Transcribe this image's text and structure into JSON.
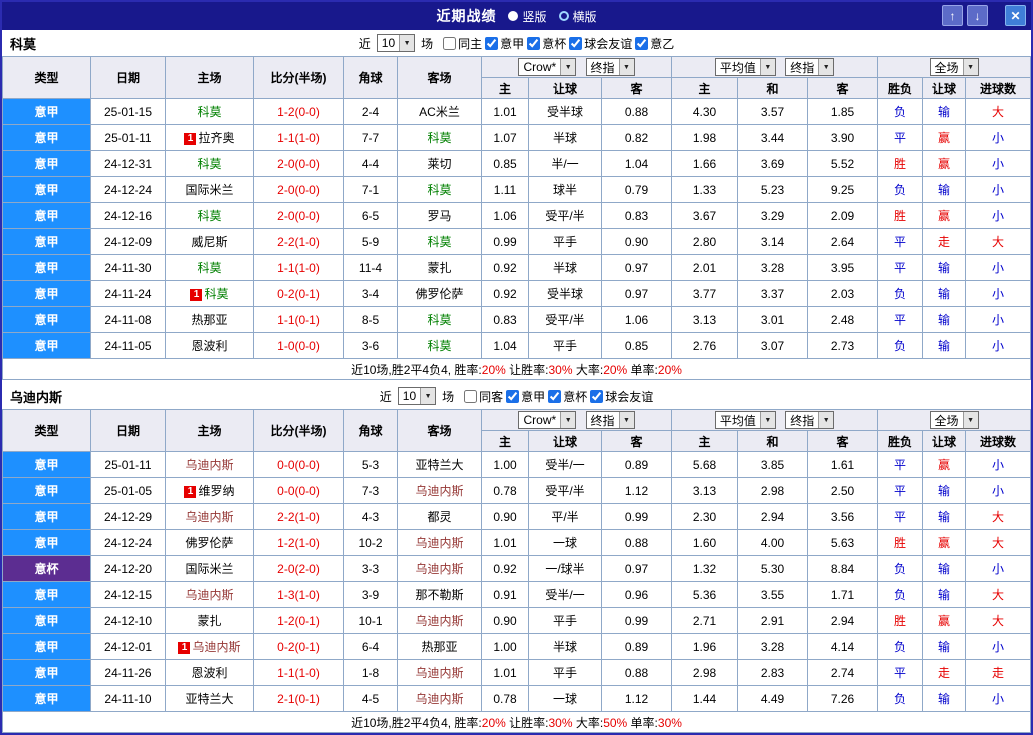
{
  "titlebar": {
    "title": "近期战绩",
    "radios": [
      {
        "label": "竖版",
        "selected": true
      },
      {
        "label": "横版",
        "selected": false
      }
    ],
    "up_icon": "↑",
    "down_icon": "↓",
    "close_icon": "✕"
  },
  "icons": {
    "dropdown_arrow": "▼"
  },
  "badges": {
    "red_card": "1"
  },
  "filter_labels": {
    "near": "近",
    "count": "10",
    "games": "场"
  },
  "table": {
    "main_cols": [
      "类型",
      "日期",
      "主场",
      "比分(半场)",
      "角球",
      "客场"
    ],
    "sub_cols": [
      "主",
      "让球",
      "客",
      "主",
      "和",
      "客",
      "胜负",
      "让球",
      "进球数"
    ],
    "selects": {
      "bookmaker": "Crow*",
      "final1": "终指",
      "average": "平均值",
      "final2": "终指",
      "scope": "全场"
    }
  },
  "colors": {
    "league_type_bg": "#1e90ff",
    "cup_type_bg": "#5c2d91",
    "score_red": "#e60000",
    "loss_blue": "#0000cc",
    "team_green": "#008000",
    "team_maroon": "#953735",
    "titlebar_bg": "#18188c"
  },
  "sections": [
    {
      "team": "科莫",
      "filters": [
        {
          "label": "同主",
          "name": "same-home",
          "checked": false
        },
        {
          "label": "意甲",
          "name": "serie-a",
          "checked": true
        },
        {
          "label": "意杯",
          "name": "coppa-italia",
          "checked": true
        },
        {
          "label": "球会友谊",
          "name": "club-friendly",
          "checked": true
        },
        {
          "label": "意乙",
          "name": "serie-b",
          "checked": true
        }
      ],
      "rows": [
        {
          "type": [
            "意甲",
            "lg"
          ],
          "date": "25-01-15",
          "home": [
            "科莫",
            "g",
            0
          ],
          "score": "1-2(0-0)",
          "corners": "2-4",
          "away": [
            "AC米兰",
            "k",
            0
          ],
          "odds": [
            "1.01",
            "受半球",
            "0.88"
          ],
          "avg": [
            "4.30",
            "3.57",
            "1.85"
          ],
          "results": [
            [
              "负",
              "b"
            ],
            [
              "输",
              "b"
            ],
            [
              "大",
              "r"
            ]
          ]
        },
        {
          "type": [
            "意甲",
            "lg"
          ],
          "date": "25-01-11",
          "home": [
            "拉齐奥",
            "k",
            1
          ],
          "score": "1-1(1-0)",
          "corners": "7-7",
          "away": [
            "科莫",
            "g",
            0
          ],
          "odds": [
            "1.07",
            "半球",
            "0.82"
          ],
          "avg": [
            "1.98",
            "3.44",
            "3.90"
          ],
          "results": [
            [
              "平",
              "b"
            ],
            [
              "赢",
              "r"
            ],
            [
              "小",
              "b"
            ]
          ]
        },
        {
          "type": [
            "意甲",
            "lg"
          ],
          "date": "24-12-31",
          "home": [
            "科莫",
            "g",
            0
          ],
          "score": "2-0(0-0)",
          "corners": "4-4",
          "away": [
            "莱切",
            "k",
            0
          ],
          "odds": [
            "0.85",
            "半/一",
            "1.04"
          ],
          "avg": [
            "1.66",
            "3.69",
            "5.52"
          ],
          "results": [
            [
              "胜",
              "r"
            ],
            [
              "赢",
              "r"
            ],
            [
              "小",
              "b"
            ]
          ]
        },
        {
          "type": [
            "意甲",
            "lg"
          ],
          "date": "24-12-24",
          "home": [
            "国际米兰",
            "k",
            0
          ],
          "score": "2-0(0-0)",
          "corners": "7-1",
          "away": [
            "科莫",
            "g",
            0
          ],
          "odds": [
            "1.11",
            "球半",
            "0.79"
          ],
          "avg": [
            "1.33",
            "5.23",
            "9.25"
          ],
          "results": [
            [
              "负",
              "b"
            ],
            [
              "输",
              "b"
            ],
            [
              "小",
              "b"
            ]
          ]
        },
        {
          "type": [
            "意甲",
            "lg"
          ],
          "date": "24-12-16",
          "home": [
            "科莫",
            "g",
            0
          ],
          "score": "2-0(0-0)",
          "corners": "6-5",
          "away": [
            "罗马",
            "k",
            0
          ],
          "odds": [
            "1.06",
            "受平/半",
            "0.83"
          ],
          "avg": [
            "3.67",
            "3.29",
            "2.09"
          ],
          "results": [
            [
              "胜",
              "r"
            ],
            [
              "赢",
              "r"
            ],
            [
              "小",
              "b"
            ]
          ]
        },
        {
          "type": [
            "意甲",
            "lg"
          ],
          "date": "24-12-09",
          "home": [
            "威尼斯",
            "k",
            0
          ],
          "score": "2-2(1-0)",
          "corners": "5-9",
          "away": [
            "科莫",
            "g",
            0
          ],
          "odds": [
            "0.99",
            "平手",
            "0.90"
          ],
          "avg": [
            "2.80",
            "3.14",
            "2.64"
          ],
          "results": [
            [
              "平",
              "b"
            ],
            [
              "走",
              "r"
            ],
            [
              "大",
              "r"
            ]
          ]
        },
        {
          "type": [
            "意甲",
            "lg"
          ],
          "date": "24-11-30",
          "home": [
            "科莫",
            "g",
            0
          ],
          "score": "1-1(1-0)",
          "corners": "11-4",
          "away": [
            "蒙扎",
            "k",
            0
          ],
          "odds": [
            "0.92",
            "半球",
            "0.97"
          ],
          "avg": [
            "2.01",
            "3.28",
            "3.95"
          ],
          "results": [
            [
              "平",
              "b"
            ],
            [
              "输",
              "b"
            ],
            [
              "小",
              "b"
            ]
          ]
        },
        {
          "type": [
            "意甲",
            "lg"
          ],
          "date": "24-11-24",
          "home": [
            "科莫",
            "g",
            1
          ],
          "score": "0-2(0-1)",
          "corners": "3-4",
          "away": [
            "佛罗伦萨",
            "k",
            0
          ],
          "odds": [
            "0.92",
            "受半球",
            "0.97"
          ],
          "avg": [
            "3.77",
            "3.37",
            "2.03"
          ],
          "results": [
            [
              "负",
              "b"
            ],
            [
              "输",
              "b"
            ],
            [
              "小",
              "b"
            ]
          ]
        },
        {
          "type": [
            "意甲",
            "lg"
          ],
          "date": "24-11-08",
          "home": [
            "热那亚",
            "k",
            0
          ],
          "score": "1-1(0-1)",
          "corners": "8-5",
          "away": [
            "科莫",
            "g",
            0
          ],
          "odds": [
            "0.83",
            "受平/半",
            "1.06"
          ],
          "avg": [
            "3.13",
            "3.01",
            "2.48"
          ],
          "results": [
            [
              "平",
              "b"
            ],
            [
              "输",
              "b"
            ],
            [
              "小",
              "b"
            ]
          ]
        },
        {
          "type": [
            "意甲",
            "lg"
          ],
          "date": "24-11-05",
          "home": [
            "恩波利",
            "k",
            0
          ],
          "score": "1-0(0-0)",
          "corners": "3-6",
          "away": [
            "科莫",
            "g",
            0
          ],
          "odds": [
            "1.04",
            "平手",
            "0.85"
          ],
          "avg": [
            "2.76",
            "3.07",
            "2.73"
          ],
          "results": [
            [
              "负",
              "b"
            ],
            [
              "输",
              "b"
            ],
            [
              "小",
              "b"
            ]
          ]
        }
      ],
      "summary": [
        [
          "近10场,胜2平4负4, 胜率:",
          "k"
        ],
        [
          "20%",
          "r"
        ],
        [
          " 让胜率:",
          "k"
        ],
        [
          "30%",
          "r"
        ],
        [
          " 大率:",
          "k"
        ],
        [
          "20%",
          "r"
        ],
        [
          " 单率:",
          "k"
        ],
        [
          "20%",
          "r"
        ]
      ]
    },
    {
      "team": "乌迪内斯",
      "filters": [
        {
          "label": "同客",
          "name": "same-away",
          "checked": false
        },
        {
          "label": "意甲",
          "name": "serie-a",
          "checked": true
        },
        {
          "label": "意杯",
          "name": "coppa-italia",
          "checked": true
        },
        {
          "label": "球会友谊",
          "name": "club-friendly",
          "checked": true
        }
      ],
      "rows": [
        {
          "type": [
            "意甲",
            "lg"
          ],
          "date": "25-01-11",
          "home": [
            "乌迪内斯",
            "m",
            0
          ],
          "score": "0-0(0-0)",
          "corners": "5-3",
          "away": [
            "亚特兰大",
            "k",
            0
          ],
          "odds": [
            "1.00",
            "受半/一",
            "0.89"
          ],
          "avg": [
            "5.68",
            "3.85",
            "1.61"
          ],
          "results": [
            [
              "平",
              "b"
            ],
            [
              "赢",
              "r"
            ],
            [
              "小",
              "b"
            ]
          ]
        },
        {
          "type": [
            "意甲",
            "lg"
          ],
          "date": "25-01-05",
          "home": [
            "维罗纳",
            "k",
            1
          ],
          "score": "0-0(0-0)",
          "corners": "7-3",
          "away": [
            "乌迪内斯",
            "m",
            0
          ],
          "odds": [
            "0.78",
            "受平/半",
            "1.12"
          ],
          "avg": [
            "3.13",
            "2.98",
            "2.50"
          ],
          "results": [
            [
              "平",
              "b"
            ],
            [
              "输",
              "b"
            ],
            [
              "小",
              "b"
            ]
          ]
        },
        {
          "type": [
            "意甲",
            "lg"
          ],
          "date": "24-12-29",
          "home": [
            "乌迪内斯",
            "m",
            0
          ],
          "score": "2-2(1-0)",
          "corners": "4-3",
          "away": [
            "都灵",
            "k",
            0
          ],
          "odds": [
            "0.90",
            "平/半",
            "0.99"
          ],
          "avg": [
            "2.30",
            "2.94",
            "3.56"
          ],
          "results": [
            [
              "平",
              "b"
            ],
            [
              "输",
              "b"
            ],
            [
              "大",
              "r"
            ]
          ]
        },
        {
          "type": [
            "意甲",
            "lg"
          ],
          "date": "24-12-24",
          "home": [
            "佛罗伦萨",
            "k",
            0
          ],
          "score": "1-2(1-0)",
          "corners": "10-2",
          "away": [
            "乌迪内斯",
            "m",
            0
          ],
          "odds": [
            "1.01",
            "一球",
            "0.88"
          ],
          "avg": [
            "1.60",
            "4.00",
            "5.63"
          ],
          "results": [
            [
              "胜",
              "r"
            ],
            [
              "赢",
              "r"
            ],
            [
              "大",
              "r"
            ]
          ]
        },
        {
          "type": [
            "意杯",
            "cup"
          ],
          "date": "24-12-20",
          "home": [
            "国际米兰",
            "k",
            0
          ],
          "score": "2-0(2-0)",
          "corners": "3-3",
          "away": [
            "乌迪内斯",
            "m",
            0
          ],
          "odds": [
            "0.92",
            "一/球半",
            "0.97"
          ],
          "avg": [
            "1.32",
            "5.30",
            "8.84"
          ],
          "results": [
            [
              "负",
              "b"
            ],
            [
              "输",
              "b"
            ],
            [
              "小",
              "b"
            ]
          ]
        },
        {
          "type": [
            "意甲",
            "lg"
          ],
          "date": "24-12-15",
          "home": [
            "乌迪内斯",
            "m",
            0
          ],
          "score": "1-3(1-0)",
          "corners": "3-9",
          "away": [
            "那不勒斯",
            "k",
            0
          ],
          "odds": [
            "0.91",
            "受半/一",
            "0.96"
          ],
          "avg": [
            "5.36",
            "3.55",
            "1.71"
          ],
          "results": [
            [
              "负",
              "b"
            ],
            [
              "输",
              "b"
            ],
            [
              "大",
              "r"
            ]
          ]
        },
        {
          "type": [
            "意甲",
            "lg"
          ],
          "date": "24-12-10",
          "home": [
            "蒙扎",
            "k",
            0
          ],
          "score": "1-2(0-1)",
          "corners": "10-1",
          "away": [
            "乌迪内斯",
            "m",
            0
          ],
          "odds": [
            "0.90",
            "平手",
            "0.99"
          ],
          "avg": [
            "2.71",
            "2.91",
            "2.94"
          ],
          "results": [
            [
              "胜",
              "r"
            ],
            [
              "赢",
              "r"
            ],
            [
              "大",
              "r"
            ]
          ]
        },
        {
          "type": [
            "意甲",
            "lg"
          ],
          "date": "24-12-01",
          "home": [
            "乌迪内斯",
            "m",
            1
          ],
          "score": "0-2(0-1)",
          "corners": "6-4",
          "away": [
            "热那亚",
            "k",
            0
          ],
          "odds": [
            "1.00",
            "半球",
            "0.89"
          ],
          "avg": [
            "1.96",
            "3.28",
            "4.14"
          ],
          "results": [
            [
              "负",
              "b"
            ],
            [
              "输",
              "b"
            ],
            [
              "小",
              "b"
            ]
          ]
        },
        {
          "type": [
            "意甲",
            "lg"
          ],
          "date": "24-11-26",
          "home": [
            "恩波利",
            "k",
            0
          ],
          "score": "1-1(1-0)",
          "corners": "1-8",
          "away": [
            "乌迪内斯",
            "m",
            0
          ],
          "odds": [
            "1.01",
            "平手",
            "0.88"
          ],
          "avg": [
            "2.98",
            "2.83",
            "2.74"
          ],
          "results": [
            [
              "平",
              "b"
            ],
            [
              "走",
              "r"
            ],
            [
              "走",
              "r"
            ]
          ]
        },
        {
          "type": [
            "意甲",
            "lg"
          ],
          "date": "24-11-10",
          "home": [
            "亚特兰大",
            "k",
            0
          ],
          "score": "2-1(0-1)",
          "corners": "4-5",
          "away": [
            "乌迪内斯",
            "m",
            0
          ],
          "odds": [
            "0.78",
            "一球",
            "1.12"
          ],
          "avg": [
            "1.44",
            "4.49",
            "7.26"
          ],
          "results": [
            [
              "负",
              "b"
            ],
            [
              "输",
              "b"
            ],
            [
              "小",
              "b"
            ]
          ]
        }
      ],
      "summary": [
        [
          "近10场,胜2平4负4, 胜率:",
          "k"
        ],
        [
          "20%",
          "r"
        ],
        [
          " 让胜率:",
          "k"
        ],
        [
          "30%",
          "r"
        ],
        [
          " 大率:",
          "k"
        ],
        [
          "50%",
          "r"
        ],
        [
          " 单率:",
          "k"
        ],
        [
          "30%",
          "r"
        ]
      ]
    }
  ]
}
